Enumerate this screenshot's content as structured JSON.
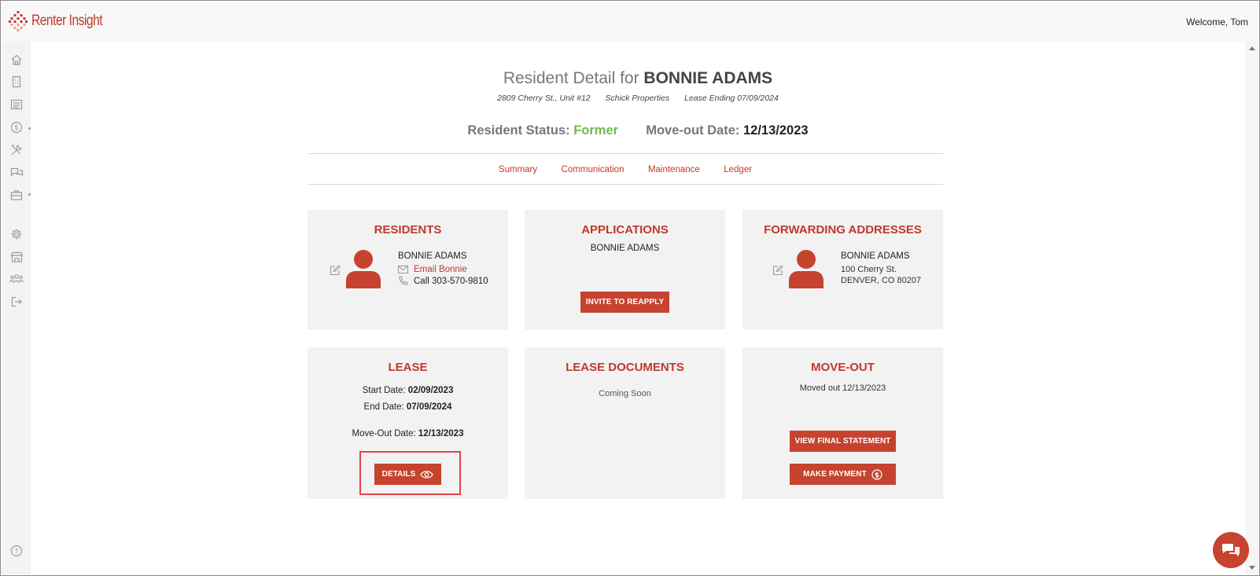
{
  "app": {
    "brand": "Renter Insight",
    "welcome": "Welcome, Tom",
    "brand_color": "#c0392b"
  },
  "sidebar": {
    "icons": [
      "home-icon",
      "building-icon",
      "list-icon",
      "dollar-icon",
      "tools-icon",
      "chat-icon",
      "briefcase-icon",
      "gear-icon",
      "store-icon",
      "users-icon",
      "logout-icon"
    ],
    "help_icon": "help-icon"
  },
  "header": {
    "title_prefix": "Resident Detail for",
    "title_name": "BONNIE ADAMS",
    "address": "2809 Cherry St., Unit #12",
    "company": "Schick Properties",
    "lease_ending": "Lease Ending 07/09/2024",
    "status_label": "Resident Status:",
    "status_value": "Former",
    "moveout_label": "Move-out Date:",
    "moveout_value": "12/13/2023"
  },
  "tabs": [
    {
      "label": "Summary"
    },
    {
      "label": "Communication"
    },
    {
      "label": "Maintenance"
    },
    {
      "label": "Ledger"
    }
  ],
  "cards": {
    "residents": {
      "title": "RESIDENTS",
      "name": "BONNIE ADAMS",
      "email_label": "Email Bonnie",
      "phone": "Call 303-570-9810"
    },
    "applications": {
      "title": "APPLICATIONS",
      "name": "BONNIE ADAMS",
      "button": "INVITE TO REAPPLY"
    },
    "forwarding": {
      "title": "FORWARDING ADDRESSES",
      "name": "BONNIE ADAMS",
      "street": "100 Cherry St.",
      "city": "DENVER, CO 80207"
    },
    "lease": {
      "title": "LEASE",
      "start_label": "Start Date:",
      "start_value": "02/09/2023",
      "end_label": "End Date:",
      "end_value": "07/09/2024",
      "moveout_label": "Move-Out Date:",
      "moveout_value": "12/13/2023",
      "button": "DETAILS"
    },
    "lease_documents": {
      "title": "LEASE DOCUMENTS",
      "text": "Coming Soon"
    },
    "moveout": {
      "title": "MOVE-OUT",
      "text": "Moved out 12/13/2023",
      "button_statement": "VIEW FINAL STATEMENT",
      "button_payment": "MAKE PAYMENT"
    }
  }
}
